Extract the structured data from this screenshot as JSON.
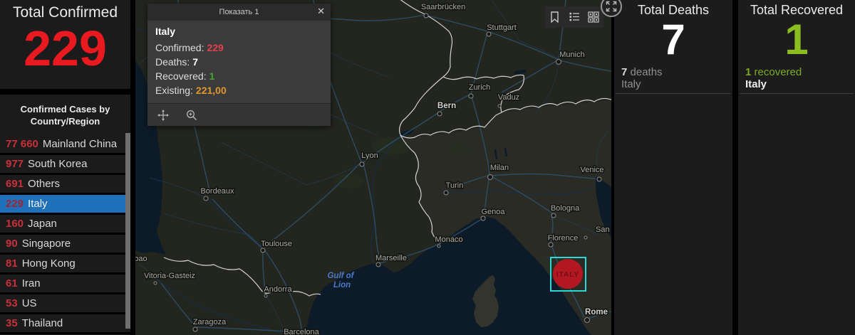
{
  "confirmed": {
    "title": "Total Confirmed",
    "value": "229"
  },
  "country_list": {
    "title": "Confirmed Cases by Country/Region",
    "items": [
      {
        "count": "77 660",
        "name": "Mainland China",
        "selected": false
      },
      {
        "count": "977",
        "name": "South Korea",
        "selected": false
      },
      {
        "count": "691",
        "name": "Others",
        "selected": false
      },
      {
        "count": "229",
        "name": "Italy",
        "selected": true
      },
      {
        "count": "160",
        "name": "Japan",
        "selected": false
      },
      {
        "count": "90",
        "name": "Singapore",
        "selected": false
      },
      {
        "count": "81",
        "name": "Hong Kong",
        "selected": false
      },
      {
        "count": "61",
        "name": "Iran",
        "selected": false
      },
      {
        "count": "53",
        "name": "US",
        "selected": false
      },
      {
        "count": "35",
        "name": "Thailand",
        "selected": false
      }
    ]
  },
  "popup": {
    "header_title": "Показать 1",
    "close_glyph": "✕",
    "country": "Italy",
    "fields": [
      {
        "label": "Confirmed:",
        "value": "229",
        "color": "#e2404e"
      },
      {
        "label": "Deaths:",
        "value": "7",
        "color": "#ffffff"
      },
      {
        "label": "Recovered:",
        "value": "1",
        "color": "#46a431"
      },
      {
        "label": "Existing:",
        "value": "221,00",
        "color": "#e0972f"
      }
    ]
  },
  "deaths": {
    "title": "Total Deaths",
    "value": "7",
    "item": {
      "count": "7",
      "label": "deaths",
      "region": "Italy"
    }
  },
  "recovered": {
    "title": "Total Recovered",
    "value": "1",
    "item": {
      "count": "1",
      "label": "recovered",
      "region": "Italy"
    }
  },
  "map": {
    "marker_label": "ITALY",
    "sea_label_1": "Gulf of",
    "sea_label_2": "Lion",
    "cities": [
      {
        "name": "Saarbrücken"
      },
      {
        "name": "Stuttgart"
      },
      {
        "name": "Munich"
      },
      {
        "name": "Zurich"
      },
      {
        "name": "Vaduz"
      },
      {
        "name": "Bern"
      },
      {
        "name": "Lyon"
      },
      {
        "name": "Milan"
      },
      {
        "name": "Venice"
      },
      {
        "name": "Turin"
      },
      {
        "name": "Genoa"
      },
      {
        "name": "Bologna"
      },
      {
        "name": "San Marino"
      },
      {
        "name": "Monaco"
      },
      {
        "name": "Florence"
      },
      {
        "name": "Toulouse"
      },
      {
        "name": "Bordeaux"
      },
      {
        "name": "Marseille"
      },
      {
        "name": "Andorra"
      },
      {
        "name": "Zaragoza"
      },
      {
        "name": "Barcelona"
      },
      {
        "name": "Rome"
      },
      {
        "name": "Vitoria-Gasteiz"
      },
      {
        "name": "Bilbao"
      }
    ]
  },
  "colors": {
    "confirmed_red": "#e8191f",
    "list_count_red": "#c9303a",
    "selected_blue": "#1e70b8",
    "recovered_green": "#8cbc1f",
    "marker_red": "#bf1722",
    "selection_cyan": "#2fd6d6",
    "sea": "#0d1b29",
    "land": "#23251f"
  }
}
